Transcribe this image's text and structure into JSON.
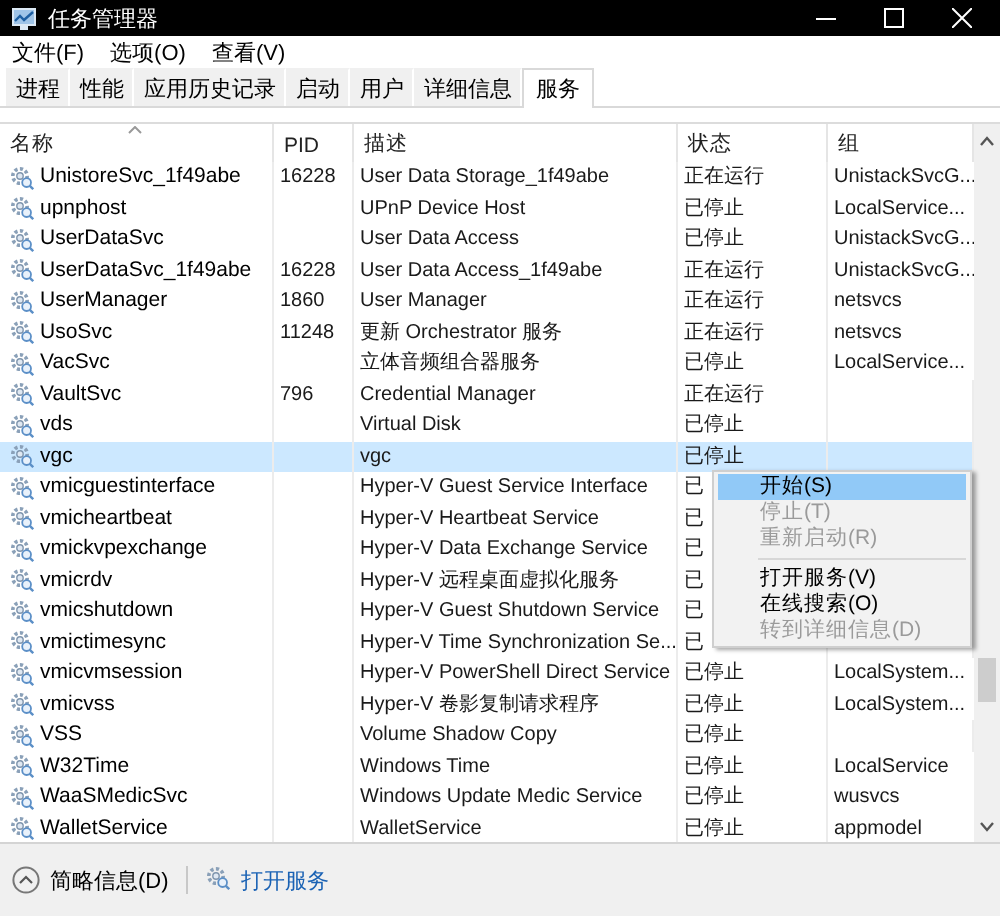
{
  "window": {
    "title": "任务管理器"
  },
  "menu": [
    "文件(F)",
    "选项(O)",
    "查看(V)"
  ],
  "tabs": [
    {
      "label": "进程",
      "selected": false
    },
    {
      "label": "性能",
      "selected": false
    },
    {
      "label": "应用历史记录",
      "selected": false
    },
    {
      "label": "启动",
      "selected": false
    },
    {
      "label": "用户",
      "selected": false
    },
    {
      "label": "详细信息",
      "selected": false
    },
    {
      "label": "服务",
      "selected": true
    }
  ],
  "table": {
    "columns": [
      {
        "label": "名称",
        "sorted": true
      },
      {
        "label": "PID",
        "sorted": false
      },
      {
        "label": "描述",
        "sorted": false
      },
      {
        "label": "状态",
        "sorted": false
      },
      {
        "label": "组",
        "sorted": false
      }
    ],
    "rows": [
      {
        "name": "UnistoreSvc_1f49abe",
        "pid": "16228",
        "description": "User Data Storage_1f49abe",
        "status": "正在运行",
        "group": "UnistackSvcG...",
        "selected": false
      },
      {
        "name": "upnphost",
        "description": "UPnP Device Host",
        "status": "已停止",
        "group": "LocalService...",
        "selected": false
      },
      {
        "name": "UserDataSvc",
        "description": "User Data Access",
        "status": "已停止",
        "group": "UnistackSvcG...",
        "selected": false
      },
      {
        "name": "UserDataSvc_1f49abe",
        "pid": "16228",
        "description": "User Data Access_1f49abe",
        "status": "正在运行",
        "group": "UnistackSvcG...",
        "selected": false
      },
      {
        "name": "UserManager",
        "pid": "1860",
        "description": "User Manager",
        "status": "正在运行",
        "group": "netsvcs",
        "selected": false
      },
      {
        "name": "UsoSvc",
        "pid": "11248",
        "description": "更新 Orchestrator 服务",
        "status": "正在运行",
        "group": "netsvcs",
        "selected": false
      },
      {
        "name": "VacSvc",
        "description": "立体音频组合器服务",
        "status": "已停止",
        "group": "LocalService...",
        "selected": false
      },
      {
        "name": "VaultSvc",
        "pid": "796",
        "description": "Credential Manager",
        "status": "正在运行",
        "selected": false
      },
      {
        "name": "vds",
        "description": "Virtual Disk",
        "status": "已停止",
        "selected": false
      },
      {
        "name": "vgc",
        "description": "vgc",
        "status": "已停止",
        "selected": true
      },
      {
        "name": "vmicguestinterface",
        "description": "Hyper-V Guest Service Interface",
        "status": "已",
        "selected": false
      },
      {
        "name": "vmicheartbeat",
        "description": "Hyper-V Heartbeat Service",
        "status": "已",
        "selected": false
      },
      {
        "name": "vmickvpexchange",
        "description": "Hyper-V Data Exchange Service",
        "status": "已",
        "selected": false
      },
      {
        "name": "vmicrdv",
        "description": "Hyper-V 远程桌面虚拟化服务",
        "status": "已",
        "selected": false
      },
      {
        "name": "vmicshutdown",
        "description": "Hyper-V Guest Shutdown Service",
        "status": "已",
        "selected": false
      },
      {
        "name": "vmictimesync",
        "description": "Hyper-V Time Synchronization Se...",
        "status": "已",
        "selected": false
      },
      {
        "name": "vmicvmsession",
        "description": "Hyper-V PowerShell Direct Service",
        "status": "已停止",
        "group": "LocalSystem...",
        "selected": false
      },
      {
        "name": "vmicvss",
        "description": "Hyper-V 卷影复制请求程序",
        "status": "已停止",
        "group": "LocalSystem...",
        "selected": false
      },
      {
        "name": "VSS",
        "description": "Volume Shadow Copy",
        "status": "已停止",
        "selected": false
      },
      {
        "name": "W32Time",
        "description": "Windows Time",
        "status": "已停止",
        "group": "LocalService",
        "selected": false
      },
      {
        "name": "WaaSMedicSvc",
        "description": "Windows Update Medic Service",
        "status": "已停止",
        "group": "wusvcs",
        "selected": false
      },
      {
        "name": "WalletService",
        "description": "WalletService",
        "status": "已停止",
        "group": "appmodel",
        "selected": false
      }
    ]
  },
  "context_menu": {
    "items": [
      {
        "kind": "item",
        "label": "开始(S)",
        "disabled": false,
        "selected": true
      },
      {
        "kind": "item",
        "label": "停止(T)",
        "disabled": true,
        "selected": false
      },
      {
        "kind": "item",
        "label": "重新启动(R)",
        "disabled": true,
        "selected": false
      },
      {
        "kind": "separator"
      },
      {
        "kind": "item",
        "label": "打开服务(V)",
        "disabled": false,
        "selected": false
      },
      {
        "kind": "item",
        "label": "在线搜索(O)",
        "disabled": false,
        "selected": false
      },
      {
        "kind": "item",
        "label": "转到详细信息(D)",
        "disabled": true,
        "selected": false
      }
    ]
  },
  "footer": {
    "summary": "简略信息(D)",
    "open_services": "打开服务"
  }
}
